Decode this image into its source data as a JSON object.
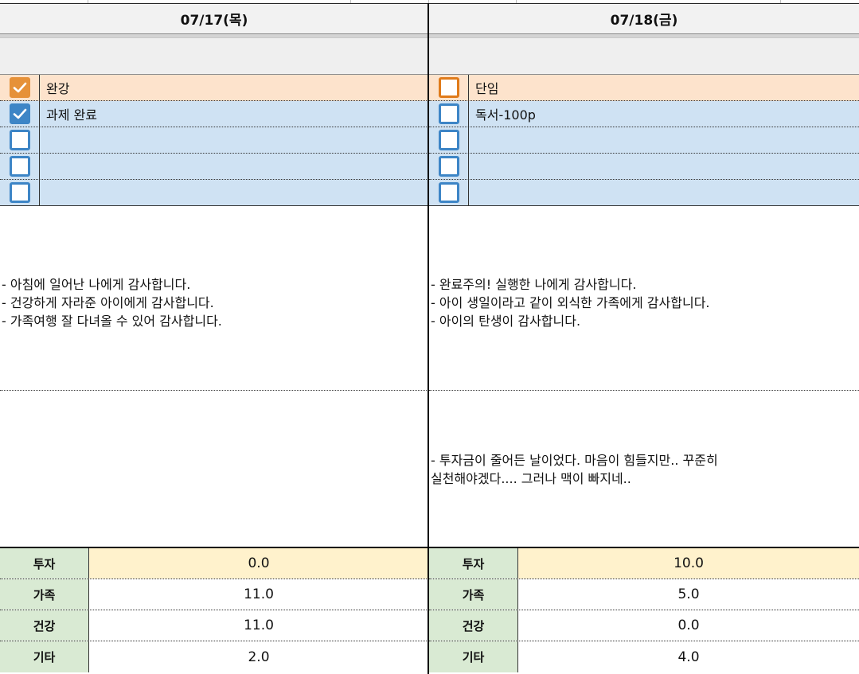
{
  "days": [
    {
      "date": "07/17(목)",
      "tasks": [
        {
          "label": "완강",
          "checked": true,
          "color": "orange"
        },
        {
          "label": "과제 완료",
          "checked": true,
          "color": "blue"
        },
        {
          "label": "",
          "checked": false,
          "color": "blue"
        },
        {
          "label": "",
          "checked": false,
          "color": "blue"
        },
        {
          "label": "",
          "checked": false,
          "color": "blue"
        }
      ],
      "gratitude": "- 아침에 일어난 나에게 감사합니다.\n- 건강하게 자라준 아이에게 감사합니다.\n- 가족여행 잘 다녀올 수 있어 감사합니다.",
      "journal": "",
      "stats": [
        {
          "key": "투자",
          "value": "0.0"
        },
        {
          "key": "가족",
          "value": "11.0"
        },
        {
          "key": "건강",
          "value": "11.0"
        },
        {
          "key": "기타",
          "value": "2.0"
        }
      ]
    },
    {
      "date": "07/18(금)",
      "tasks": [
        {
          "label": "단임",
          "checked": false,
          "color": "orange"
        },
        {
          "label": "독서-100p",
          "checked": false,
          "color": "blue"
        },
        {
          "label": "",
          "checked": false,
          "color": "blue"
        },
        {
          "label": "",
          "checked": false,
          "color": "blue"
        },
        {
          "label": "",
          "checked": false,
          "color": "blue"
        }
      ],
      "gratitude": "- 완료주의! 실행한 나에게 감사합니다.\n- 아이 생일이라고 같이 외식한 가족에게 감사합니다.\n- 아이의 탄생이 감사합니다.",
      "journal": "- 투자금이 줄어든 날이었다. 마음이 힘들지만.. 꾸준히\n실천해야겠다.... 그러나 맥이 빠지네..",
      "stats": [
        {
          "key": "투자",
          "value": "10.0"
        },
        {
          "key": "가족",
          "value": "5.0"
        },
        {
          "key": "건강",
          "value": "0.0"
        },
        {
          "key": "기타",
          "value": "4.0"
        }
      ]
    }
  ],
  "colors": {
    "orange_row": "#fde3cc",
    "blue_row": "#cfe2f3",
    "checkbox_orange": "#e69138",
    "checkbox_blue": "#3d85c6",
    "stat_key_bg": "#d9ead3",
    "invest_value_bg": "#fff2cc"
  },
  "icons": {
    "checked": "checkmark-icon"
  }
}
